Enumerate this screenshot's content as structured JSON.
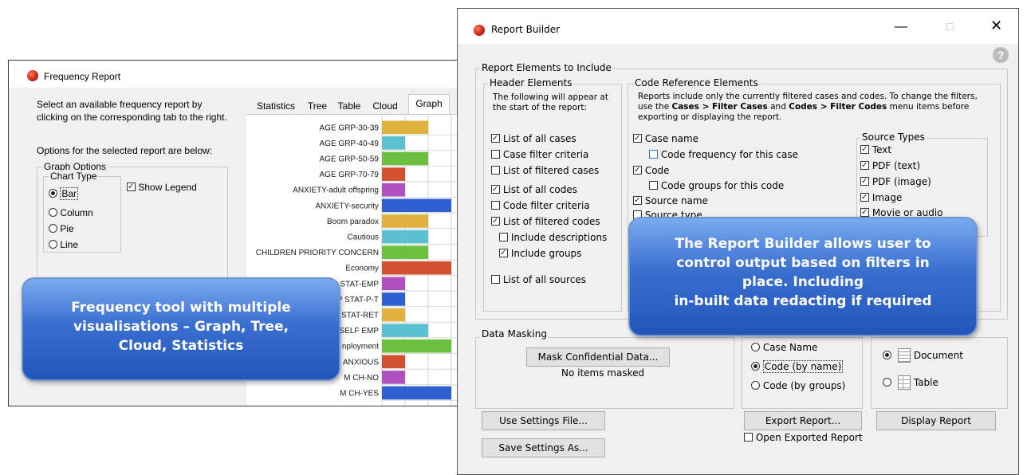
{
  "freq_window": {
    "title": "Frequency Report",
    "description": "Select an available frequency report by clicking on the corresponding tab to the right.",
    "options_text": "Options for the selected report are below:",
    "graph_options_label": "Graph Options",
    "chart_type_label": "Chart Type",
    "chart_types": [
      "Bar",
      "Column",
      "Pie",
      "Line"
    ],
    "selected_chart_type": "Bar",
    "show_legend_label": "Show Legend",
    "show_legend_checked": true,
    "tabs": [
      "Statistics",
      "Tree",
      "Table",
      "Cloud",
      "Graph"
    ],
    "active_tab": "Graph"
  },
  "chart_data": {
    "type": "bar",
    "categories": [
      "AGE GRP-30-39",
      "AGE GRP-40-49",
      "AGE GRP-50-59",
      "AGE GRP-70-79",
      "ANXIETY-adult offspring",
      "ANXIETY-security",
      "Boom paradox",
      "Cautious",
      "CHILDREN PRIORITY CONCERN",
      "Economy",
      "EMP STAT-EMP",
      "P STAT-P-T",
      "STAT-RET",
      "SELF EMP",
      "nployment",
      "ANXIOUS",
      "M CH-NO",
      "M CH-YES"
    ],
    "values": [
      2,
      1,
      2,
      1,
      1,
      3,
      2,
      2,
      2,
      3,
      1,
      1,
      1,
      2,
      3,
      1,
      1,
      3
    ],
    "colors": [
      "#e0b040",
      "#5bc0d0",
      "#6cc040",
      "#d05030",
      "#b050c0",
      "#3060d0",
      "#e0b040",
      "#5bc0d0",
      "#6cc040",
      "#d05030",
      "#b050c0",
      "#3060d0",
      "#e0b040",
      "#5bc0d0",
      "#6cc040",
      "#d05030",
      "#b050c0",
      "#3060d0"
    ]
  },
  "rb_window": {
    "title": "Report Builder",
    "report_elements_label": "Report Elements to Include",
    "header_elements_label": "Header Elements",
    "header_note": "The following will appear at the start of the report:",
    "header_items": [
      {
        "label": "List of all cases",
        "checked": true
      },
      {
        "label": "Case filter criteria",
        "checked": false
      },
      {
        "label": "List of filtered cases",
        "checked": false
      },
      {
        "label": "List of all codes",
        "checked": true
      },
      {
        "label": "Code filter criteria",
        "checked": false
      },
      {
        "label": "List of filtered codes",
        "checked": true
      },
      {
        "label": "Include descriptions",
        "checked": false
      },
      {
        "label": "Include groups",
        "checked": true
      },
      {
        "label": "List of all sources",
        "checked": false
      }
    ],
    "code_ref_label": "Code Reference Elements",
    "code_ref_note_1": "Reports include only the currently filtered cases and codes. To change the filters, use the",
    "code_ref_note_cases": "Cases > Filter Cases",
    "code_ref_note_and": "and",
    "code_ref_note_codes": "Codes > Filter Codes",
    "code_ref_note_2": "menu items before exporting or displaying the report.",
    "code_ref_items": [
      {
        "label": "Case name",
        "checked": true
      },
      {
        "label": "Code frequency for this case",
        "checked": false
      },
      {
        "label": "Code",
        "checked": true
      },
      {
        "label": "Code groups for this code",
        "checked": false
      },
      {
        "label": "Source name",
        "checked": true
      },
      {
        "label": "Source type",
        "checked": false
      }
    ],
    "source_types_label": "Source Types",
    "source_types": [
      {
        "label": "Text",
        "checked": true
      },
      {
        "label": "PDF (text)",
        "checked": true
      },
      {
        "label": "PDF (image)",
        "checked": true
      },
      {
        "label": "Image",
        "checked": true
      },
      {
        "label": "Movie or audio",
        "checked": true
      }
    ],
    "data_masking_label": "Data Masking",
    "mask_button": "Mask Confidential Data...",
    "no_items_masked": "No items masked",
    "sort_options": [
      {
        "label": "Case Name",
        "selected": false
      },
      {
        "label": "Code (by name)",
        "selected": true
      },
      {
        "label": "Code (by groups)",
        "selected": false
      }
    ],
    "format_options": [
      {
        "label": "Document",
        "selected": true
      },
      {
        "label": "Table",
        "selected": false
      }
    ],
    "use_settings_button": "Use Settings File...",
    "save_settings_button": "Save Settings As...",
    "export_button": "Export Report...",
    "open_exported_label": "Open Exported Report",
    "open_exported_checked": false,
    "display_button": "Display Report",
    "help_icon": "question-circle-icon"
  },
  "callouts": {
    "left": "Frequency tool with multiple visualisations – Graph, Tree, Cloud, Statistics",
    "right_line1": "The Report Builder allows user to control output based on filters in place. Including",
    "right_line2": "in-built data redacting if required"
  }
}
